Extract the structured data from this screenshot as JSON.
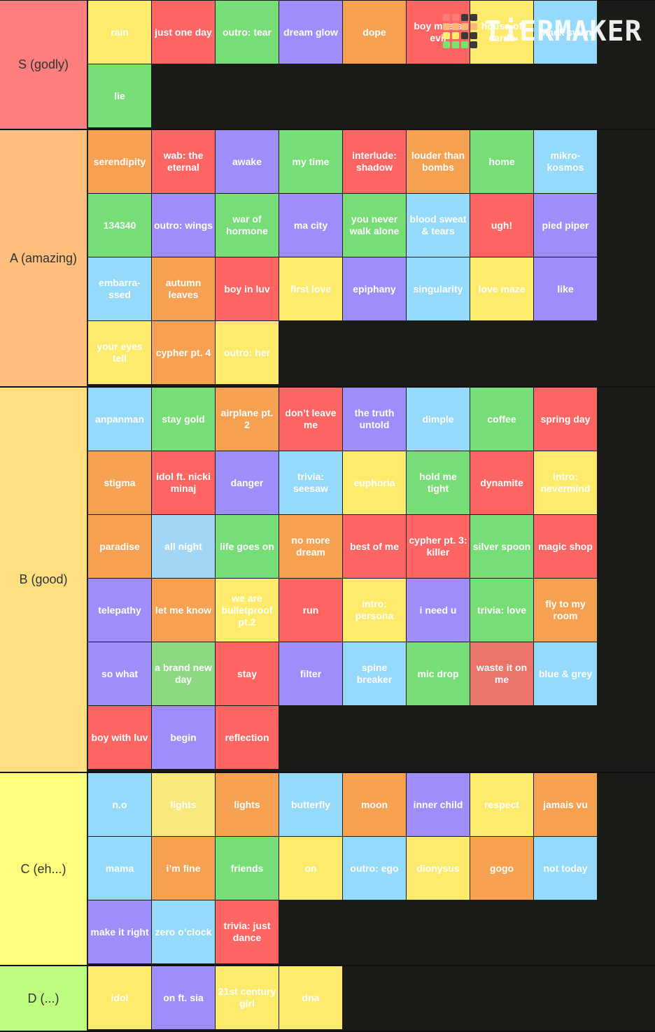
{
  "colors": {
    "red": "#ff6663",
    "orange": "#f6a052",
    "yellow": "#ffeb6b",
    "green": "#77dd77",
    "blue": "#95d9fb",
    "purple": "#9d8efc",
    "lightgreen": "#8ed883",
    "darkred": "#ea736a",
    "paleblue": "#a3d6f5",
    "paleyellow": "#f6e87a"
  },
  "logo": {
    "text": "TiERMAKER",
    "grid": [
      "#ff7b7b",
      "#ff7b7b",
      "#3a3a3a",
      "#3a3a3a",
      "#ffb87a",
      "#ffb87a",
      "#ffb87a",
      "#ffb87a",
      "#fff06b",
      "#fff06b",
      "#3a3a3a",
      "#3a3a3a",
      "#6fe86f",
      "#6fe86f",
      "#6fe86f",
      "#3a3a3a"
    ]
  },
  "tiers": [
    {
      "label": "S (godly)",
      "color": "#ff7f7e",
      "items": [
        {
          "t": "rain",
          "c": "yellow"
        },
        {
          "t": "just one day",
          "c": "red"
        },
        {
          "t": "outro: tear",
          "c": "green"
        },
        {
          "t": "dream glow",
          "c": "purple"
        },
        {
          "t": "dope",
          "c": "orange"
        },
        {
          "t": "boy meets evil",
          "c": "red"
        },
        {
          "t": "house of cards",
          "c": "yellow"
        },
        {
          "t": "black swan",
          "c": "blue"
        },
        {
          "t": "lie",
          "c": "green"
        }
      ]
    },
    {
      "label": "A (amazing)",
      "color": "#ffbf7f",
      "items": [
        {
          "t": "serendipity",
          "c": "orange"
        },
        {
          "t": "wab: the eternal",
          "c": "red"
        },
        {
          "t": "awake",
          "c": "purple"
        },
        {
          "t": "my time",
          "c": "green"
        },
        {
          "t": "interlude: shadow",
          "c": "red"
        },
        {
          "t": "louder than bombs",
          "c": "orange"
        },
        {
          "t": "home",
          "c": "green"
        },
        {
          "t": "mikro-kosmos",
          "c": "blue"
        },
        {
          "t": "134340",
          "c": "green"
        },
        {
          "t": "outro: wings",
          "c": "purple"
        },
        {
          "t": "war of hormone",
          "c": "green"
        },
        {
          "t": "ma city",
          "c": "purple"
        },
        {
          "t": "you never walk alone",
          "c": "green"
        },
        {
          "t": "blood sweat & tears",
          "c": "blue"
        },
        {
          "t": "ugh!",
          "c": "red"
        },
        {
          "t": "pied piper",
          "c": "purple"
        },
        {
          "t": "embarra-ssed",
          "c": "blue"
        },
        {
          "t": "autumn leaves",
          "c": "orange"
        },
        {
          "t": "boy in luv",
          "c": "red"
        },
        {
          "t": "first love",
          "c": "yellow"
        },
        {
          "t": "epiphany",
          "c": "purple"
        },
        {
          "t": "singularity",
          "c": "blue"
        },
        {
          "t": "love maze",
          "c": "yellow"
        },
        {
          "t": "like",
          "c": "purple"
        },
        {
          "t": "your eyes tell",
          "c": "yellow"
        },
        {
          "t": "cypher pt. 4",
          "c": "orange"
        },
        {
          "t": "outro: her",
          "c": "yellow"
        }
      ]
    },
    {
      "label": "B (good)",
      "color": "#ffdf7f",
      "items": [
        {
          "t": "anpanman",
          "c": "blue"
        },
        {
          "t": "stay gold",
          "c": "green"
        },
        {
          "t": "airplane pt. 2",
          "c": "orange"
        },
        {
          "t": "don’t leave me",
          "c": "red"
        },
        {
          "t": "the truth untold",
          "c": "purple"
        },
        {
          "t": "dimple",
          "c": "blue"
        },
        {
          "t": "coffee",
          "c": "green"
        },
        {
          "t": "spring day",
          "c": "red"
        },
        {
          "t": "stigma",
          "c": "orange"
        },
        {
          "t": "idol ft. nicki minaj",
          "c": "red"
        },
        {
          "t": "danger",
          "c": "purple"
        },
        {
          "t": "trivia: seesaw",
          "c": "blue"
        },
        {
          "t": "euphoria",
          "c": "yellow"
        },
        {
          "t": "hold me tight",
          "c": "green"
        },
        {
          "t": "dynamite",
          "c": "red"
        },
        {
          "t": "intro: nevermind",
          "c": "yellow"
        },
        {
          "t": "paradise",
          "c": "orange"
        },
        {
          "t": "all night",
          "c": "paleblue"
        },
        {
          "t": "life goes on",
          "c": "green"
        },
        {
          "t": "no more dream",
          "c": "orange"
        },
        {
          "t": "best of me",
          "c": "red"
        },
        {
          "t": "cypher pt. 3: killer",
          "c": "red"
        },
        {
          "t": "silver spoon",
          "c": "green"
        },
        {
          "t": "magic shop",
          "c": "red"
        },
        {
          "t": "telepathy",
          "c": "purple"
        },
        {
          "t": "let me know",
          "c": "orange"
        },
        {
          "t": "we are bulletproof pt.2",
          "c": "yellow"
        },
        {
          "t": "run",
          "c": "red"
        },
        {
          "t": "intro: persona",
          "c": "yellow"
        },
        {
          "t": "i need u",
          "c": "purple"
        },
        {
          "t": "trivia: love",
          "c": "green"
        },
        {
          "t": "fly to my room",
          "c": "orange"
        },
        {
          "t": "so what",
          "c": "purple"
        },
        {
          "t": "a brand new day",
          "c": "lightgreen"
        },
        {
          "t": "stay",
          "c": "red"
        },
        {
          "t": "filter",
          "c": "purple"
        },
        {
          "t": "spine breaker",
          "c": "blue"
        },
        {
          "t": "mic drop",
          "c": "green"
        },
        {
          "t": "waste it on me",
          "c": "darkred"
        },
        {
          "t": "blue & grey",
          "c": "blue"
        },
        {
          "t": "boy with luv",
          "c": "red"
        },
        {
          "t": "begin",
          "c": "purple"
        },
        {
          "t": "reflection",
          "c": "red"
        }
      ]
    },
    {
      "label": "C (eh...)",
      "color": "#ffff7f",
      "items": [
        {
          "t": "n.o",
          "c": "blue"
        },
        {
          "t": "lights",
          "c": "paleyellow"
        },
        {
          "t": "lights",
          "c": "orange"
        },
        {
          "t": "butterfly",
          "c": "blue"
        },
        {
          "t": "moon",
          "c": "orange"
        },
        {
          "t": "inner child",
          "c": "purple"
        },
        {
          "t": "respect",
          "c": "yellow"
        },
        {
          "t": "jamais vu",
          "c": "orange"
        },
        {
          "t": "mama",
          "c": "blue"
        },
        {
          "t": "i’m fine",
          "c": "orange"
        },
        {
          "t": "friends",
          "c": "green"
        },
        {
          "t": "on",
          "c": "yellow"
        },
        {
          "t": "outro: ego",
          "c": "blue"
        },
        {
          "t": "dionysus",
          "c": "yellow"
        },
        {
          "t": "gogo",
          "c": "orange"
        },
        {
          "t": "not today",
          "c": "blue"
        },
        {
          "t": "make it right",
          "c": "purple"
        },
        {
          "t": "zero o’clock",
          "c": "blue"
        },
        {
          "t": "trivia: just dance",
          "c": "red"
        }
      ]
    },
    {
      "label": "D (...)",
      "color": "#bfff7f",
      "items": [
        {
          "t": "idol",
          "c": "yellow"
        },
        {
          "t": "on ft. sia",
          "c": "purple"
        },
        {
          "t": "21st century girl",
          "c": "yellow"
        },
        {
          "t": "dna",
          "c": "yellow"
        }
      ]
    }
  ]
}
